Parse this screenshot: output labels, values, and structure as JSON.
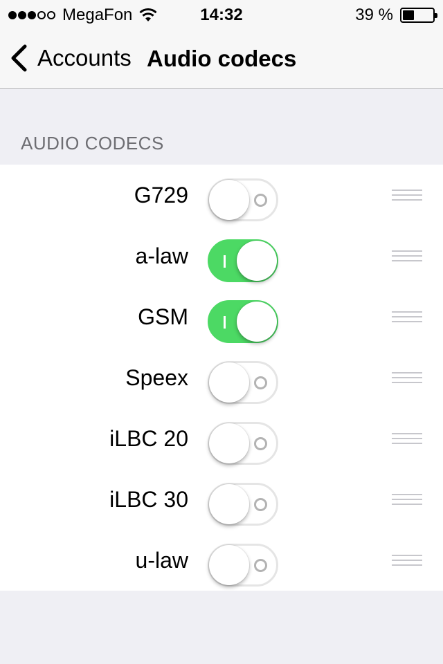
{
  "status_bar": {
    "carrier": "MegaFon",
    "time": "14:32",
    "battery_percent": "39 %",
    "battery_level": 0.39,
    "signal_strength_dots": 3,
    "signal_total_dots": 5
  },
  "nav": {
    "back_label": "Accounts",
    "title": "Audio codecs"
  },
  "section": {
    "header": "AUDIO CODECS"
  },
  "codecs": [
    {
      "name": "G729",
      "enabled": false
    },
    {
      "name": "a-law",
      "enabled": true
    },
    {
      "name": "GSM",
      "enabled": true
    },
    {
      "name": "Speex",
      "enabled": false
    },
    {
      "name": "iLBC 20",
      "enabled": false
    },
    {
      "name": "iLBC 30",
      "enabled": false
    },
    {
      "name": "u-law",
      "enabled": false
    }
  ],
  "colors": {
    "toggle_on": "#4cd964",
    "background": "#efeff4",
    "section_header": "#6d6d72"
  },
  "icons": {
    "back": "chevron-left-icon",
    "wifi": "wifi-icon",
    "battery": "battery-icon",
    "reorder": "reorder-icon"
  }
}
